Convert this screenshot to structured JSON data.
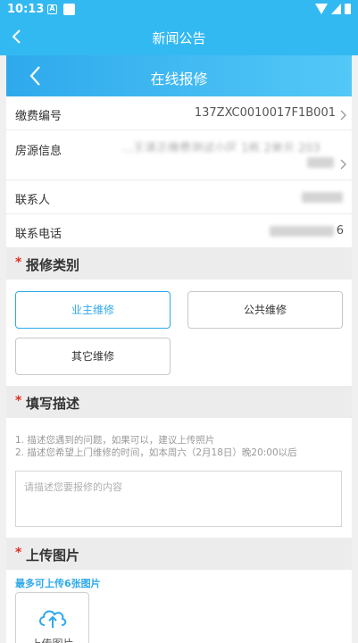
{
  "status_bar": {
    "time": "10:13",
    "notif_letter": "A"
  },
  "app_bar": {
    "title": "新闻公告"
  },
  "page_header": {
    "title": "在线报修"
  },
  "info": {
    "fee_number": {
      "label": "缴费编号",
      "value": "137ZXC0010017F1B001"
    },
    "house_info": {
      "label": "房源信息",
      "value": "…王清正缴费测试小区 1栋 2单元 203"
    },
    "contact": {
      "label": "联系人"
    },
    "phone": {
      "label": "联系电话",
      "value_tail": "6"
    }
  },
  "repair_type": {
    "title": "报修类别",
    "required_mark": "*",
    "options": [
      "业主维修",
      "公共维修",
      "其它维修"
    ],
    "selected": "业主维修"
  },
  "description": {
    "title": "填写描述",
    "required_mark": "*",
    "hints": [
      "1. 描述您遇到的问题，如果可以，建议上传照片",
      "2. 描述您希望上门维修的时间，如本周六（2月18日）晚20:00以后"
    ],
    "placeholder": "请描述您要报修的内容"
  },
  "upload": {
    "title": "上传图片",
    "required_mark": "*",
    "limit_text": "最多可上传6张图片",
    "button_label": "上传图片"
  },
  "colors": {
    "accent": "#33b9f2",
    "required": "#e0301e"
  }
}
